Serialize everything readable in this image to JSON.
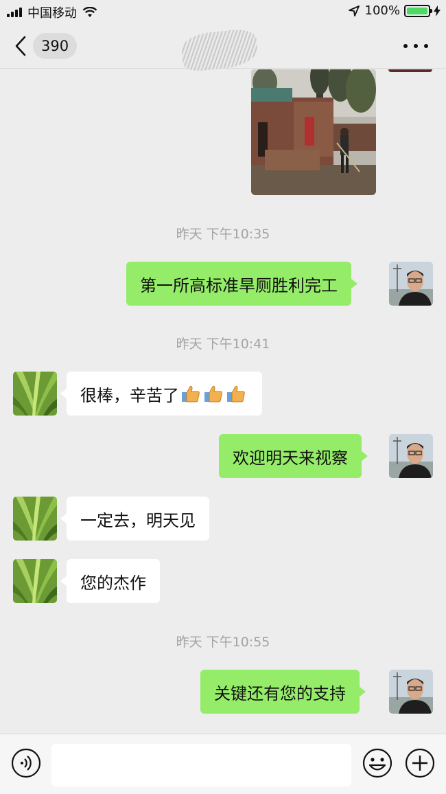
{
  "status_bar": {
    "carrier": "中国移动",
    "battery_percent": "100%",
    "icons": [
      "signal-icon",
      "wifi-icon",
      "location-icon",
      "battery-icon",
      "charging-icon"
    ]
  },
  "nav": {
    "back_icon": "chevron-left-icon",
    "unread_count": "390",
    "more_icon": "more-dots-icon"
  },
  "messages": {
    "ts1": "昨天 下午10:35",
    "m1": "第一所高标准旱厕胜利完工",
    "ts2": "昨天 下午10:41",
    "m2": "很棒，辛苦了",
    "m2_emoji": "thumbs-up-icon ×3",
    "m3": "欢迎明天来视察",
    "m4": "一定去，明天见",
    "m5": "您的杰作",
    "ts3": "昨天 下午10:55",
    "m6": "关键还有您的支持"
  },
  "input_bar": {
    "value": "",
    "icons": [
      "voice-icon",
      "emoji-icon",
      "plus-icon"
    ]
  },
  "colors": {
    "background": "#ededed",
    "my_bubble": "#95ec69",
    "other_bubble": "#ffffff",
    "timestamp": "#a3a3a3"
  }
}
